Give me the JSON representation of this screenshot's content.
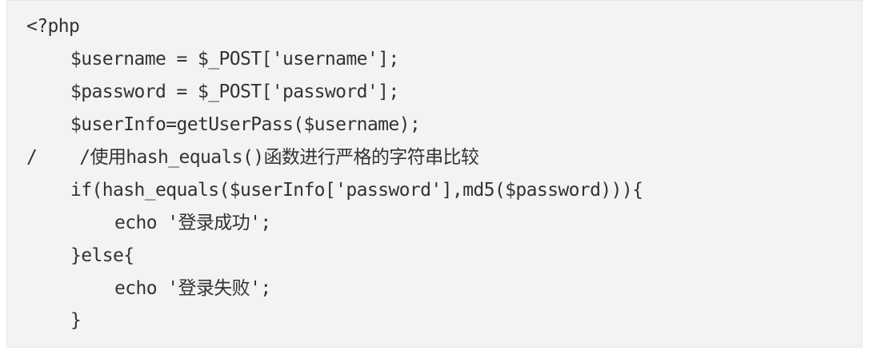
{
  "code": {
    "lines": [
      "<?php",
      "$username = $_POST['username'];",
      "$password = $_POST['password'];",
      "$userInfo=getUserPass($username);",
      "/    /使用hash_equals()函数进行严格的字符串比较",
      "if(hash_equals($userInfo['password'],md5($password))){",
      "echo '登录成功';",
      "}else{",
      "echo '登录失败';",
      "}"
    ]
  },
  "colors": {
    "background": "#f3f3f3",
    "text": "#333333"
  }
}
